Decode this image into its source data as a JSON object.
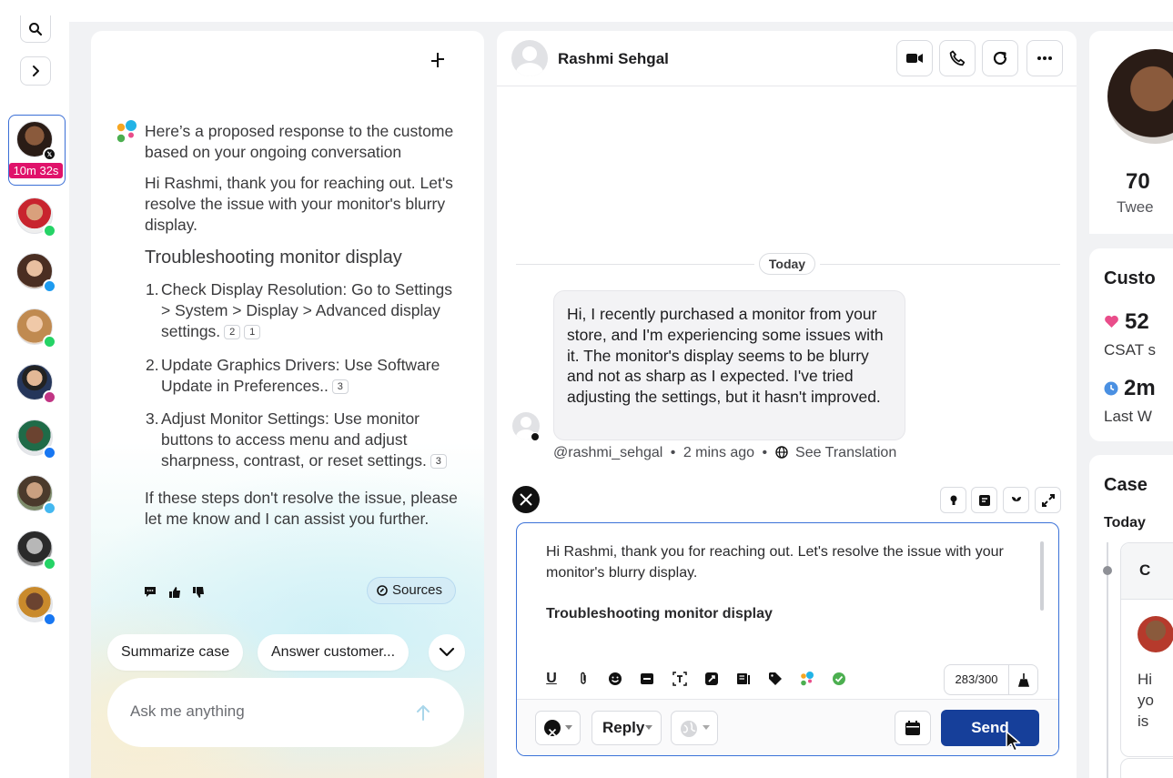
{
  "rail": {
    "timer": "10m 32s",
    "contacts": [
      {
        "channel": "x",
        "color": "#111111"
      },
      {
        "channel": "whatsapp",
        "color": "#25d366"
      },
      {
        "channel": "twitter",
        "color": "#1d9bf0"
      },
      {
        "channel": "whatsapp",
        "color": "#25d366"
      },
      {
        "channel": "instagram",
        "color": "#c13584"
      },
      {
        "channel": "facebook",
        "color": "#1877f2"
      },
      {
        "channel": "messenger",
        "color": "#44b8f0"
      },
      {
        "channel": "whatsapp",
        "color": "#25d366"
      },
      {
        "channel": "facebook",
        "color": "#1877f2"
      }
    ]
  },
  "ai": {
    "intro": "Here’s a proposed response to the custome based on your ongoing conversation",
    "greeting": "Hi Rashmi, thank you for reaching out. Let's resolve the issue with your monitor's blurry display.",
    "heading": "Troubleshooting monitor display",
    "steps": [
      {
        "text": "Check Display Resolution: Go to Settings > System > Display > Advanced display settings.",
        "badges": [
          "2",
          "1"
        ]
      },
      {
        "text": "Update Graphics Drivers:  Use Software Update in Preferences..",
        "badges": [
          "3"
        ]
      },
      {
        "text": "Adjust Monitor Settings:  Use monitor buttons to access menu and adjust sharpness, contrast, or reset settings.",
        "badges": [
          "3"
        ]
      }
    ],
    "closing": "If these steps don't resolve the issue, please let me know and I can assist you further.",
    "sources_label": "Sources",
    "chips": [
      "Summarize case",
      "Answer customer..."
    ],
    "ask_placeholder": "Ask me anything"
  },
  "conversation": {
    "contact_name": "Rashmi Sehgal",
    "today_label": "Today",
    "message": "Hi, I recently purchased a monitor from your store, and I'm experiencing some issues with it. The monitor's display seems to be blurry and not as sharp as I expected. I've tried adjusting the settings, but it hasn't improved.",
    "handle": "@rashmi_sehgal",
    "time_ago": "2 mins ago",
    "see_translation": "See Translation",
    "composer_line1": "Hi Rashmi, thank you for reaching out. Let's resolve the issue with your monitor's blurry display.",
    "composer_heading": "Troubleshooting monitor display",
    "char_count": "283/300",
    "reply_label": "Reply",
    "send_label": "Send"
  },
  "right": {
    "tweets_count": "70",
    "tweets_label": "Twee",
    "customer_title": "Custo",
    "csat_value": "52",
    "csat_label": "CSAT s",
    "wait_value": "2m",
    "wait_label": "Last W",
    "case_title": "Case",
    "case_today": "Today",
    "case_item_letter": "C",
    "case_preview": [
      "Hi",
      "yo",
      "is"
    ]
  }
}
